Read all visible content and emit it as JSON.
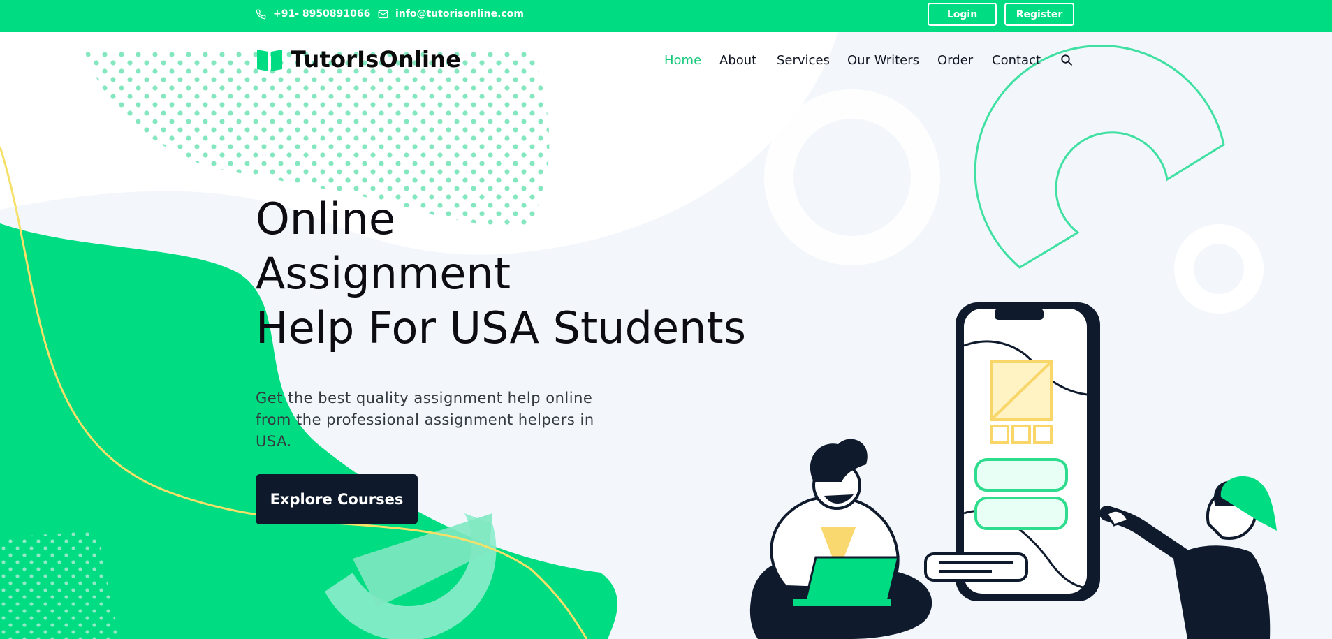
{
  "topbar": {
    "phone": "+91- 8950891066",
    "email": "info@tutorisonline.com",
    "login_label": "Login",
    "register_label": "Register"
  },
  "brand": {
    "name": "TutorIsOnline"
  },
  "nav": {
    "items": [
      {
        "label": "Home",
        "active": true
      },
      {
        "label": "About"
      },
      {
        "label": "Services"
      },
      {
        "label": "Our Writers"
      },
      {
        "label": "Order"
      },
      {
        "label": "Contact"
      }
    ],
    "search_icon": "search-icon"
  },
  "hero": {
    "title_lines": [
      "Online",
      "Assignment",
      "Help For USA Students"
    ],
    "subtitle": "Get the best quality assignment help online from the professional assignment helpers in USA.",
    "cta_label": "Explore Courses"
  },
  "colors": {
    "accent": "#00dc82",
    "dark": "#0e1a2b",
    "background": "#f3f7fb"
  }
}
